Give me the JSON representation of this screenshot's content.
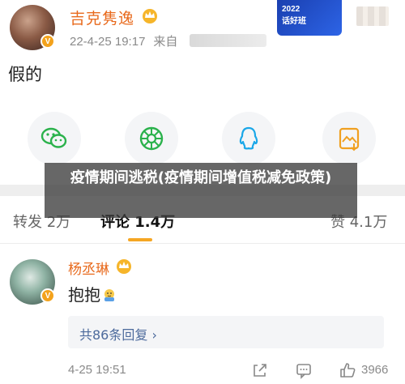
{
  "post": {
    "author": "吉克隽逸",
    "time": "22-4-25 19:17",
    "source_prefix": "来自",
    "text": "假的",
    "promo_year": "2022",
    "promo_text": "话好班"
  },
  "share_icons": [
    "wechat-icon",
    "moments-icon",
    "qq-icon",
    "save-image-icon"
  ],
  "banner": {
    "title": "疫情期间逃税(疫情期间增值税减免政策)"
  },
  "tabs": {
    "repost": "转发 2万",
    "comment": "评论 1.4万",
    "like": "赞 4.1万"
  },
  "comment": {
    "author": "杨丞琳",
    "text": "抱抱",
    "replies": "共86条回复",
    "replies_arrow": "›",
    "time": "4-25 19:51",
    "like_count": "3966"
  },
  "colors": {
    "accent_orange": "#e86a1d",
    "tab_indicator": "#f5a623",
    "link_blue": "#4c6a9c"
  }
}
